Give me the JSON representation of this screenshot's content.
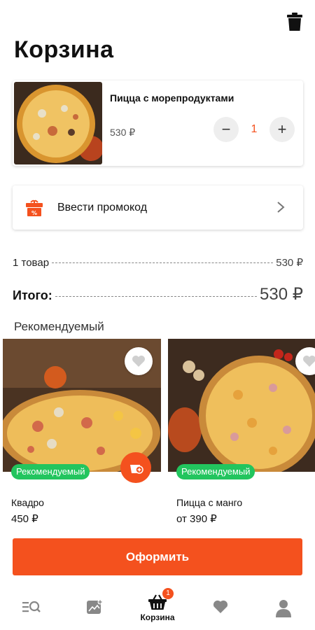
{
  "header": {
    "title": "Корзина",
    "trash_icon": "trash-icon"
  },
  "cart_item": {
    "name": "Пицца с морепродуктами",
    "price": "530 ₽",
    "quantity": "1",
    "minus": "−",
    "plus": "+"
  },
  "promo": {
    "label": "Ввести промокод",
    "icon": "gift-icon"
  },
  "summary": {
    "items_label": "1 товар",
    "items_value": "530 ₽",
    "total_label": "Итого:",
    "total_value": "530 ₽"
  },
  "recommended": {
    "heading": "Рекомендуемый",
    "cards": [
      {
        "badge": "Рекомендуемый",
        "name": "Квадро",
        "price": "450 ₽"
      },
      {
        "badge": "Рекомендуемый",
        "name": "Пицца с манго",
        "price": "от 390 ₽"
      }
    ]
  },
  "checkout": {
    "label": "Оформить"
  },
  "tabbar": {
    "tabs": [
      {
        "icon": "menu-search-icon",
        "label": ""
      },
      {
        "icon": "promo-image-icon",
        "label": ""
      },
      {
        "icon": "basket-icon",
        "label": "Корзина",
        "badge": "1"
      },
      {
        "icon": "heart-icon",
        "label": ""
      },
      {
        "icon": "profile-icon",
        "label": ""
      }
    ]
  },
  "colors": {
    "accent": "#f4511e",
    "badge_green": "#22c55e",
    "icon_gray": "#888888"
  }
}
